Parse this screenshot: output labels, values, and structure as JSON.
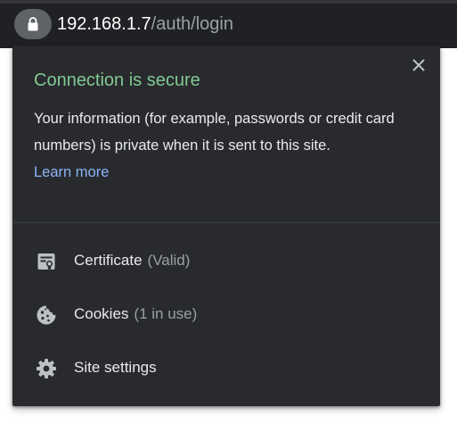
{
  "omnibox": {
    "host": "192.168.1.7",
    "path": "/auth/login",
    "lock_icon": "lock-icon"
  },
  "popup": {
    "title": "Connection is secure",
    "description": "Your information (for example, passwords or credit card numbers) is private when it is sent to this site.",
    "learn_more": "Learn more",
    "close_icon": "close-icon",
    "items": [
      {
        "label": "Certificate",
        "detail": "(Valid)",
        "icon": "certificate-icon"
      },
      {
        "label": "Cookies",
        "detail": "(1 in use)",
        "icon": "cookie-icon"
      },
      {
        "label": "Site settings",
        "detail": "",
        "icon": "gear-icon"
      }
    ]
  },
  "colors": {
    "secure_title": "#81c995",
    "link": "#8ab4f8",
    "popup_bg": "#292a2d",
    "toolbar_bg": "#202124"
  }
}
